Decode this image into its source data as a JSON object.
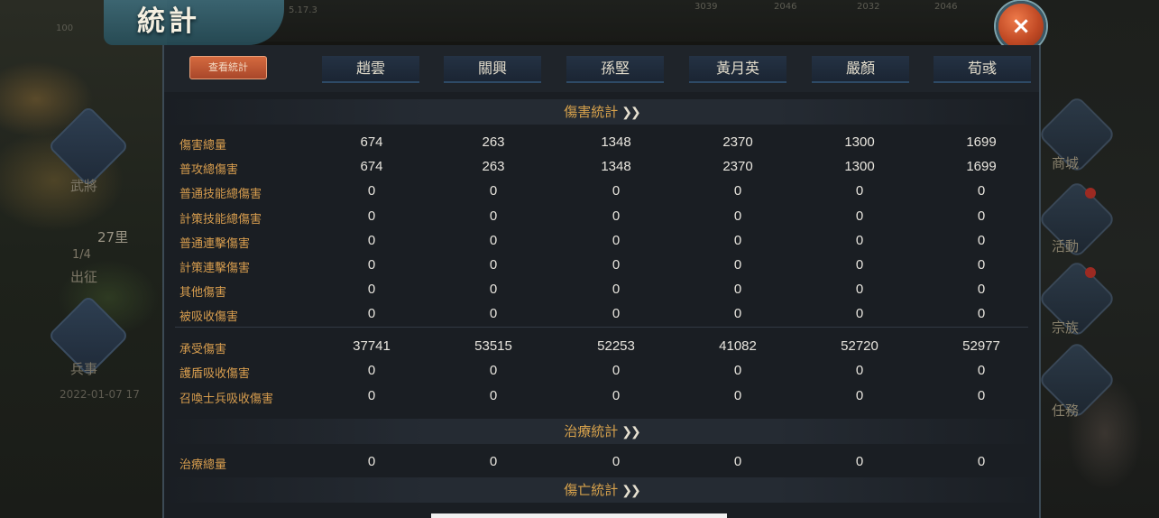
{
  "title": "統計",
  "close_label": "×",
  "background": {
    "top_texts": [
      "100",
      "5.17.3",
      "3039",
      "2046",
      "2032",
      "2046"
    ],
    "left_labels": [
      "武將",
      "出征",
      "兵事"
    ],
    "timestamp": "2022-01-07 17",
    "distance": "27里",
    "fraction": "1/4",
    "right_labels": [
      "商城",
      "活動",
      "宗族",
      "任務"
    ]
  },
  "tabs": {
    "active": "查看統計",
    "heroes": [
      "趙雲",
      "關興",
      "孫堅",
      "黃月英",
      "嚴顏",
      "荀彧"
    ]
  },
  "sections": {
    "damage": {
      "title": "傷害統計",
      "rows": [
        {
          "label": "傷害總量",
          "values": [
            "674",
            "263",
            "1348",
            "2370",
            "1300",
            "1699"
          ]
        },
        {
          "label": "普攻總傷害",
          "values": [
            "674",
            "263",
            "1348",
            "2370",
            "1300",
            "1699"
          ]
        },
        {
          "label": "普通技能總傷害",
          "values": [
            "0",
            "0",
            "0",
            "0",
            "0",
            "0"
          ]
        },
        {
          "label": "計策技能總傷害",
          "values": [
            "0",
            "0",
            "0",
            "0",
            "0",
            "0"
          ]
        },
        {
          "label": "普通連擊傷害",
          "values": [
            "0",
            "0",
            "0",
            "0",
            "0",
            "0"
          ]
        },
        {
          "label": "計策連擊傷害",
          "values": [
            "0",
            "0",
            "0",
            "0",
            "0",
            "0"
          ]
        },
        {
          "label": "其他傷害",
          "values": [
            "0",
            "0",
            "0",
            "0",
            "0",
            "0"
          ]
        },
        {
          "label": "被吸收傷害",
          "values": [
            "0",
            "0",
            "0",
            "0",
            "0",
            "0"
          ]
        }
      ],
      "rows_taken": [
        {
          "label": "承受傷害",
          "values": [
            "37741",
            "53515",
            "52253",
            "41082",
            "52720",
            "52977"
          ]
        },
        {
          "label": "護盾吸收傷害",
          "values": [
            "0",
            "0",
            "0",
            "0",
            "0",
            "0"
          ]
        },
        {
          "label": "召喚士兵吸收傷害",
          "values": [
            "0",
            "0",
            "0",
            "0",
            "0",
            "0"
          ]
        }
      ]
    },
    "heal": {
      "title": "治療統計",
      "rows": [
        {
          "label": "治療總量",
          "values": [
            "0",
            "0",
            "0",
            "0",
            "0",
            "0"
          ]
        }
      ]
    },
    "death": {
      "title": "傷亡統計"
    }
  }
}
